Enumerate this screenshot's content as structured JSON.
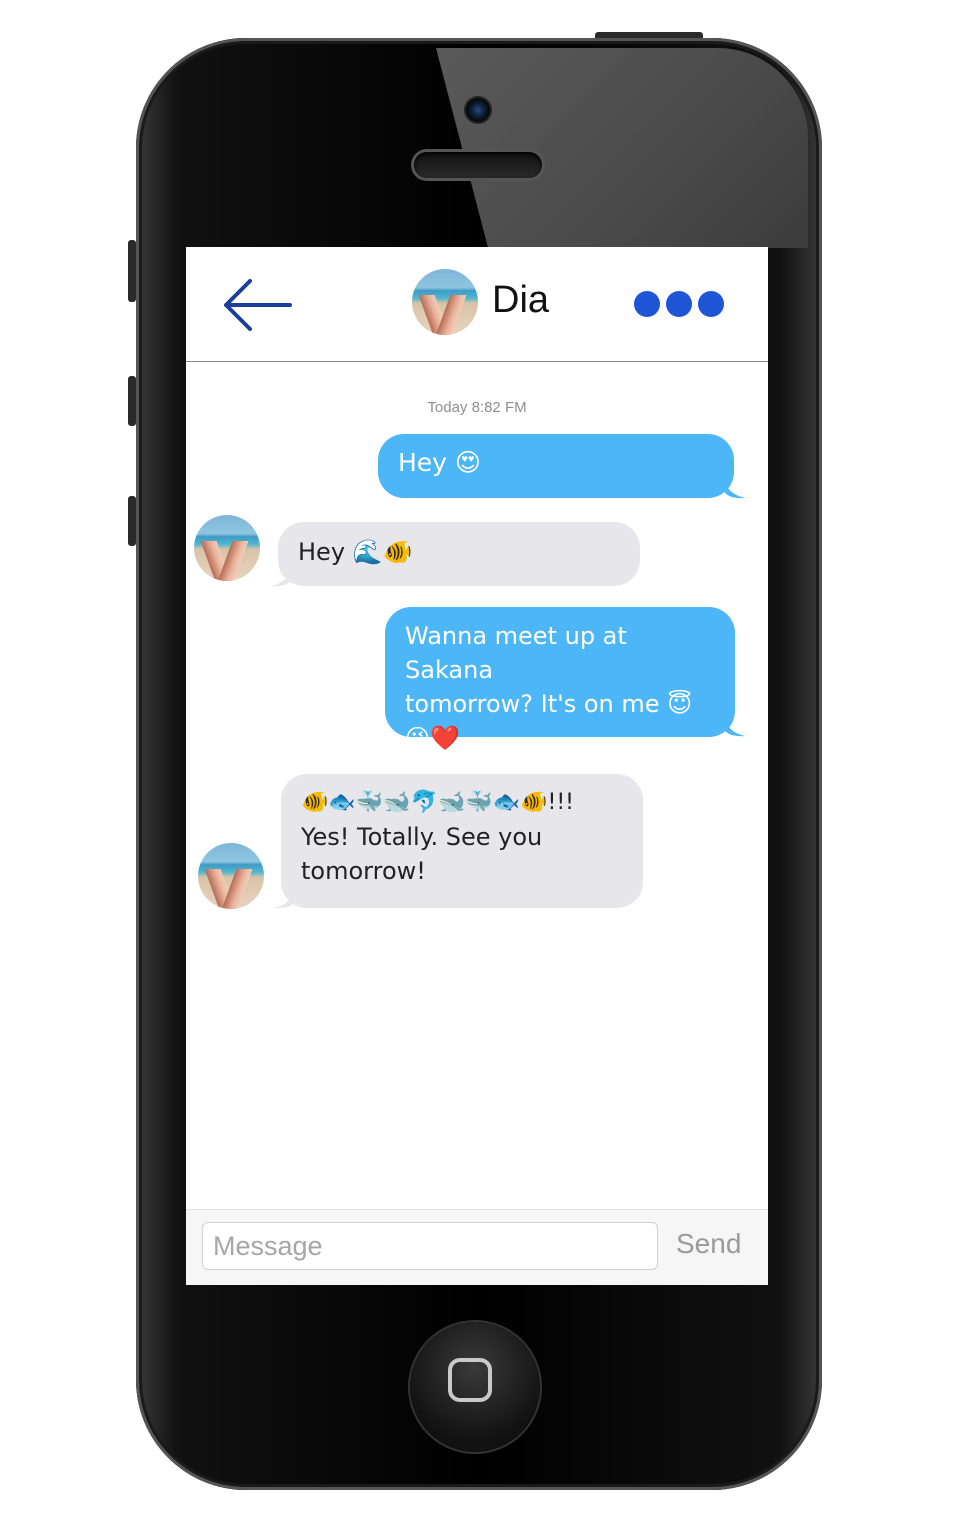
{
  "header": {
    "contact_name": "Dia",
    "back_icon": "arrow-left-icon",
    "more_icon": "ellipsis-icon"
  },
  "conversation": {
    "timestamp": "Today 8:82 FM",
    "messages": [
      {
        "from": "me",
        "text": "Hey 😍"
      },
      {
        "from": "Dia",
        "text": "Hey 🌊🐠"
      },
      {
        "from": "me",
        "line1": "Wanna meet up at Sakana",
        "line2": "tomorrow? It's on me 😇",
        "line3": "😘❤️"
      },
      {
        "from": "Dia",
        "line1": "🐠🐟🐳🐋🐬🐋🐳🐟🐠!!!",
        "line2": "Yes! Totally. See you",
        "line3": "tomorrow!"
      }
    ]
  },
  "composer": {
    "placeholder": "Message",
    "send_label": "Send"
  },
  "colors": {
    "sent_bubble": "#4db6f7",
    "received_bubble": "#e6e6eb",
    "accent": "#1d55d6"
  }
}
